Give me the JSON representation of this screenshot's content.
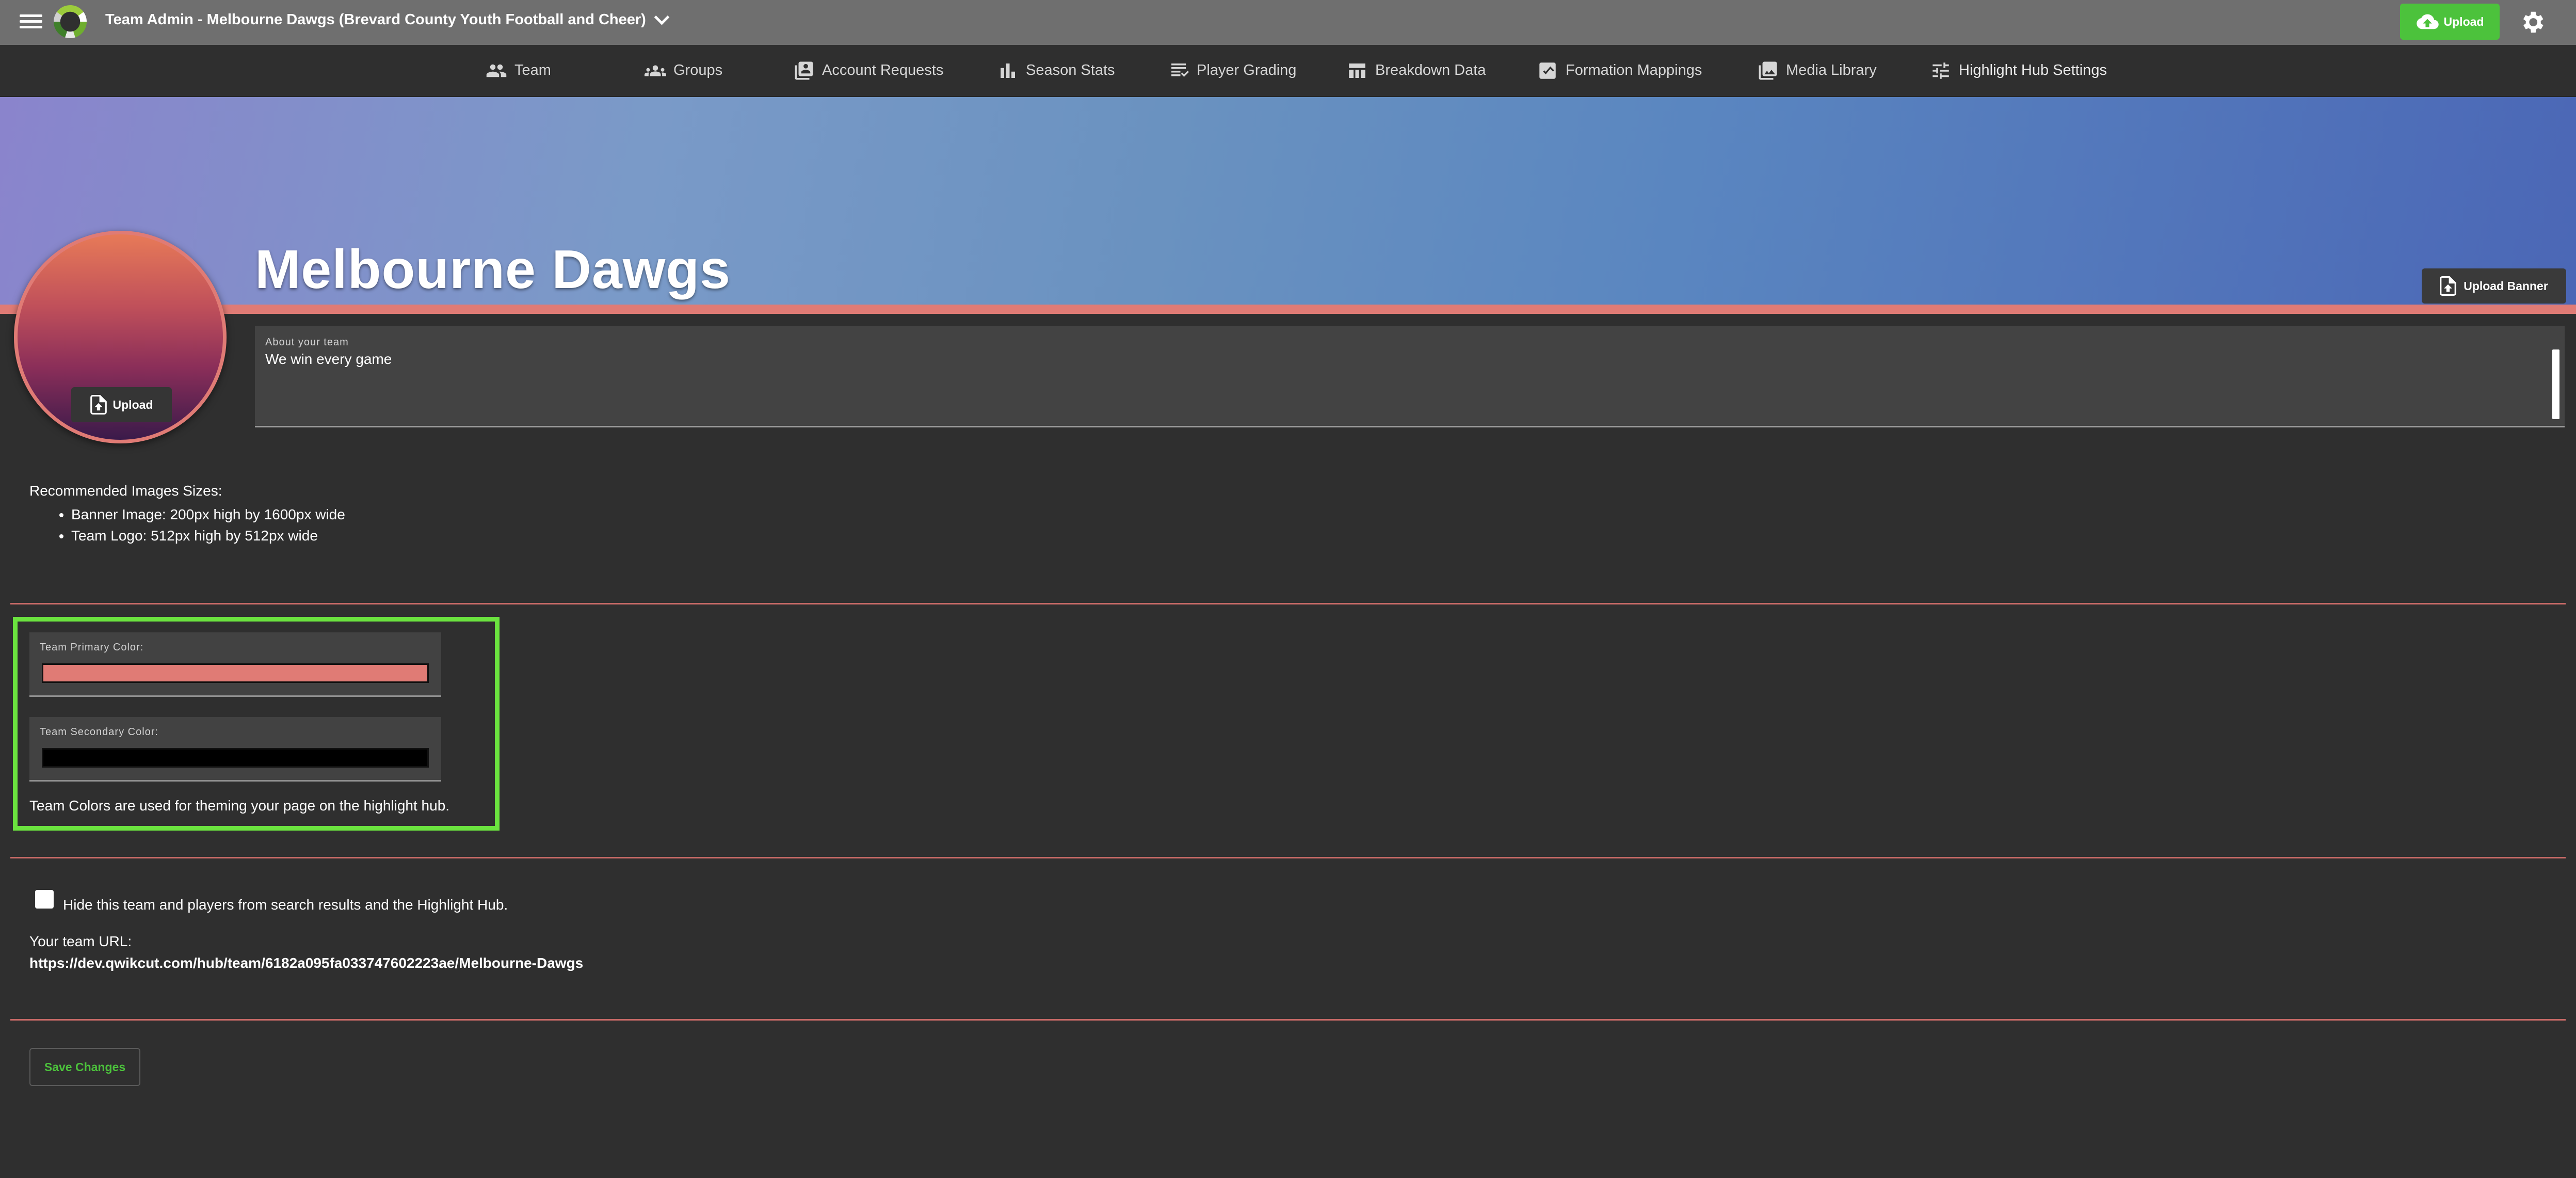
{
  "app": {
    "title": "Team Admin - Melbourne Dawgs (Brevard County Youth Football and Cheer)",
    "upload_label": "Upload"
  },
  "tabs": [
    {
      "label": "Team",
      "icon": "people-icon"
    },
    {
      "label": "Groups",
      "icon": "groups-icon"
    },
    {
      "label": "Account Requests",
      "icon": "account-requests-icon"
    },
    {
      "label": "Season Stats",
      "icon": "bar-chart-icon"
    },
    {
      "label": "Player Grading",
      "icon": "grading-icon"
    },
    {
      "label": "Breakdown Data",
      "icon": "table-icon"
    },
    {
      "label": "Formation Mappings",
      "icon": "formation-icon"
    },
    {
      "label": "Media Library",
      "icon": "media-icon"
    },
    {
      "label": "Highlight Hub Settings",
      "icon": "tune-icon",
      "active": true
    }
  ],
  "banner": {
    "team_name": "Melbourne Dawgs",
    "upload_banner_label": "Upload Banner",
    "upload_logo_label": "Upload"
  },
  "about": {
    "label": "About your team",
    "value": "We win every game"
  },
  "recommended": {
    "title": "Recommended Images Sizes:",
    "items": [
      "Banner Image: 200px high by 1600px wide",
      "Team Logo: 512px high by 512px wide"
    ]
  },
  "colors": {
    "primary_label": "Team Primary Color:",
    "primary_value": "#e07b75",
    "secondary_label": "Team Secondary Color:",
    "secondary_value": "#000000",
    "note": "Team Colors are used for theming your page on the highlight hub."
  },
  "visibility": {
    "hide_label": "Hide this team and players from search results and the Highlight Hub.",
    "hide_checked": false,
    "url_label": "Your team URL:",
    "url_value": "https://dev.qwikcut.com/hub/team/6182a095fa033747602223ae/Melbourne-Dawgs"
  },
  "actions": {
    "save_label": "Save Changes"
  },
  "theme": {
    "accent": "#4cc23c",
    "highlight_box": "#6be33f"
  }
}
